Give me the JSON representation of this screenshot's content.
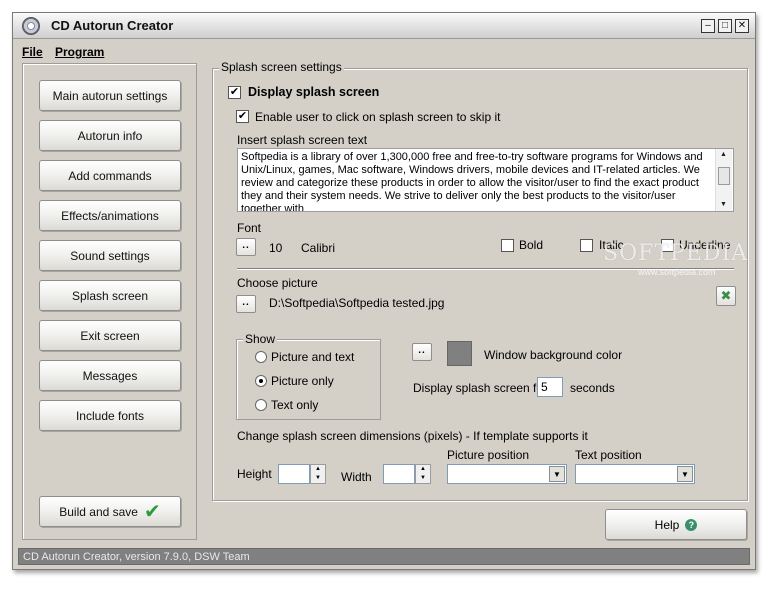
{
  "window": {
    "title": "CD Autorun Creator",
    "controls": {
      "minimize": "–",
      "maximize": "□",
      "close": "✕"
    }
  },
  "menu": {
    "items": [
      "File",
      "Program"
    ]
  },
  "nav": {
    "items": [
      "Main autorun settings",
      "Autorun info",
      "Add commands",
      "Effects/animations",
      "Sound settings",
      "Splash screen",
      "Exit screen",
      "Messages",
      "Include fonts"
    ],
    "build_label": "Build and save"
  },
  "splash": {
    "group_title": "Splash screen settings",
    "display_label": "Display splash screen",
    "display_checked": true,
    "skip_label": "Enable user to click on splash screen to skip it",
    "skip_checked": true,
    "insert_text_label": "Insert splash screen text",
    "splash_text": "Softpedia is a library of over 1,300,000 free and free-to-try software programs for Windows and Unix/Linux, games, Mac software, Windows drivers, mobile devices and IT-related articles. We review and categorize these products in order to allow the visitor/user to find the exact product they and their system needs. We strive to deliver only the best products to the visitor/user together with",
    "font": {
      "label": "Font",
      "browse": "..",
      "size": "10",
      "name": "Calibri",
      "bold_label": "Bold",
      "italic_label": "Italic",
      "underline_label": "Underline"
    },
    "picture": {
      "label": "Choose picture",
      "browse": "..",
      "path": "D:\\Softpedia\\Softpedia tested.jpg",
      "clear_icon": "✖"
    },
    "show": {
      "title": "Show",
      "options": [
        "Picture and text",
        "Picture only",
        "Text only"
      ],
      "selected": "Picture only"
    },
    "background": {
      "browse": "..",
      "label": "Window background color",
      "color": "#808080"
    },
    "duration": {
      "label": "Display splash screen for",
      "value": "5",
      "unit": "seconds"
    },
    "dimensions": {
      "label": "Change splash screen dimensions (pixels) - If template supports it",
      "height_label": "Height",
      "width_label": "Width",
      "height_value": "",
      "width_value": "",
      "picture_position_label": "Picture position",
      "text_position_label": "Text position",
      "picture_position_value": "",
      "text_position_value": ""
    }
  },
  "help": {
    "label": "Help"
  },
  "status": {
    "text": "CD Autorun Creator, version 7.9.0, DSW Team"
  },
  "watermark": {
    "text": "SOFTPEDIA",
    "url": "www.softpedia.com"
  },
  "icons": {
    "app": "cd-disc-icon",
    "build": "green-checkmark-icon",
    "help": "help-icon",
    "clear_picture": "clear-icon"
  }
}
